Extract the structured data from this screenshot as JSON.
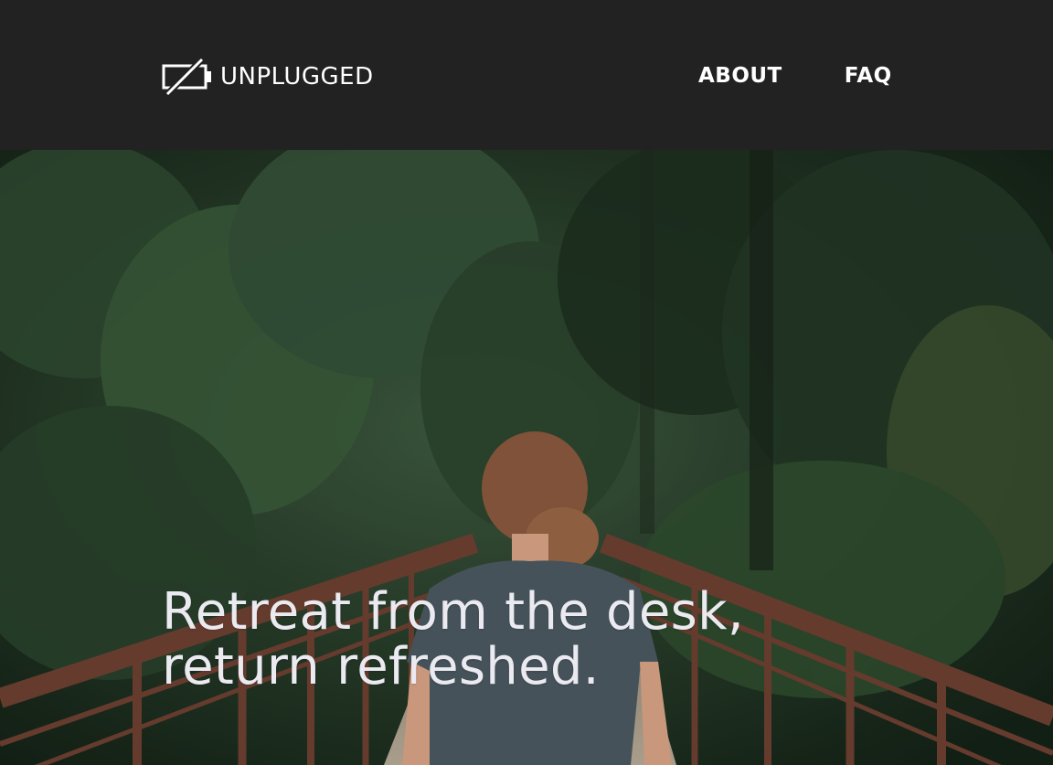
{
  "brand": {
    "name": "UNPLUGGED",
    "icon": "crossed-out-battery-icon"
  },
  "nav": {
    "items": [
      {
        "label": "ABOUT"
      },
      {
        "label": "FAQ"
      }
    ]
  },
  "hero": {
    "headline_line1": "Retreat from the desk,",
    "headline_line2": "return refreshed.",
    "image": "person-on-forest-bridge"
  },
  "colors": {
    "header_bg": "#222222",
    "text": "#ffffff",
    "headline": "#eaeaf0"
  }
}
